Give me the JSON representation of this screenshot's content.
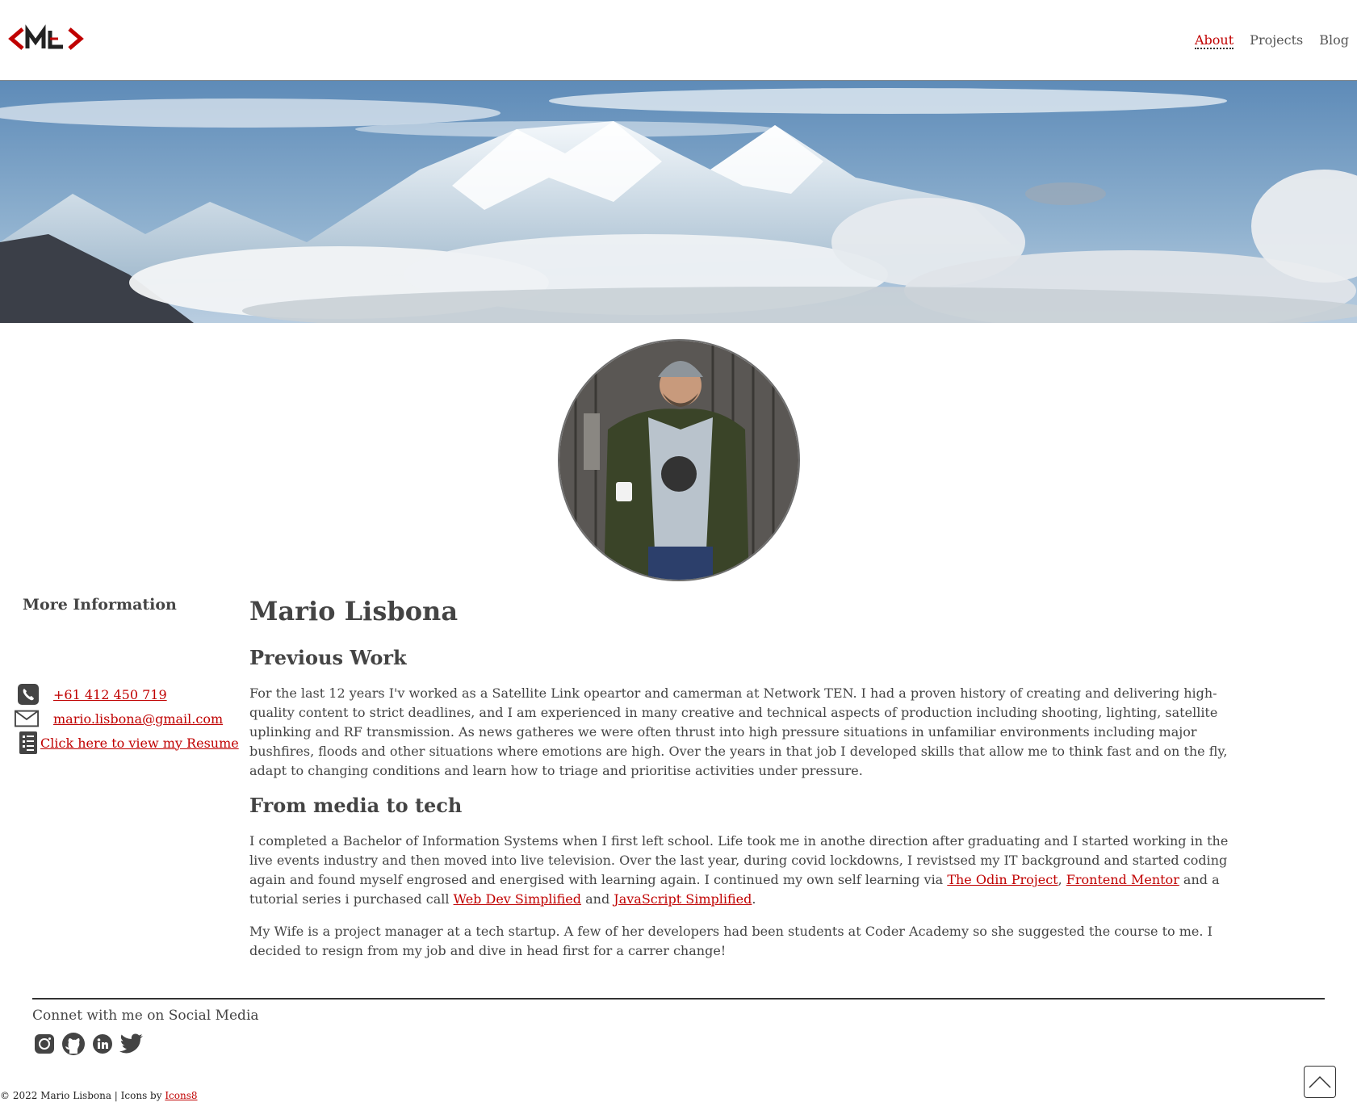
{
  "header": {
    "logo_text": "<ML>",
    "nav": [
      {
        "label": "About",
        "active": true
      },
      {
        "label": "Projects",
        "active": false
      },
      {
        "label": "Blog",
        "active": false
      }
    ]
  },
  "sidebar": {
    "title": "More Information",
    "phone": "+61 412 450 719",
    "email": "mario.lisbona@gmail.com",
    "resume": "Click here to view my Resume"
  },
  "main": {
    "name": "Mario Lisbona",
    "sections": [
      {
        "heading": "Previous Work",
        "paragraph": "For the last 12 years I'v worked as a Satellite Link opeartor and camerman at Network TEN. I had a proven history of creating and delivering high-quality content to strict deadlines, and I am experienced in many creative and technical aspects of production including shooting, lighting, satellite uplinking and RF transmission. As news gatheres we were often thrust into high pressure situations in unfamiliar environments including major bushfires, floods and other situations where emotions are high. Over the years in that job I developed skills that allow me to think fast and on the fly, adapt to changing conditions and learn how to triage and prioritise activities under pressure."
      },
      {
        "heading": "From media to tech",
        "p1_a": "I completed a Bachelor of Information Systems when I first left school. Life took me in anothe direction after graduating and I started working in the live events industry and then moved into live television. Over the last year, during covid lockdowns, I revistsed my IT background and started coding again and found myself engrosed and energised with learning again. I continued my own self learning via ",
        "link_odin": "The Odin Project",
        "sep_comma": ", ",
        "link_fm": "Frontend Mentor",
        "p1_b": " and a tutorial series i purchased call ",
        "link_wds": "Web Dev Simplified",
        "p1_and": " and ",
        "link_js": "JavaScript Simplified",
        "p1_end": ".",
        "p2": "My Wife is a project manager at a tech startup. A few of her developers had been students at Coder Academy so she suggested the course to me. I decided to resign from my job and dive in head first for a carrer change!"
      }
    ]
  },
  "footer": {
    "social_title": "Connet with me on Social Media",
    "social_icons": [
      "instagram-icon",
      "github-icon",
      "linkedin-icon",
      "twitter-icon"
    ],
    "copyright": "© 2022 Mario Lisbona | Icons by ",
    "icons_link": "Icons8"
  },
  "colors": {
    "accent": "#c00000",
    "text": "#444444",
    "icon": "#444444"
  }
}
